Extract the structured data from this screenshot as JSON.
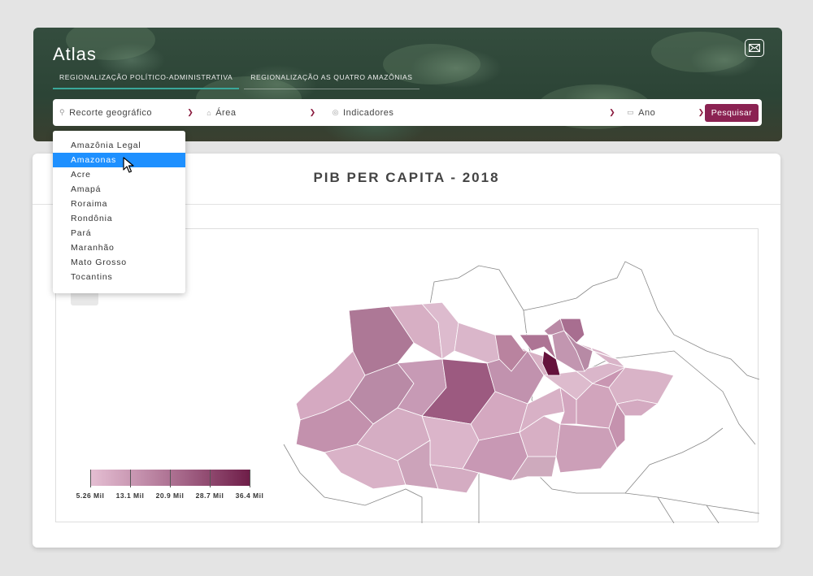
{
  "header": {
    "title": "Atlas",
    "tabs": [
      {
        "label": "REGIONALIZAÇÃO POLÍTICO-ADMINISTRATIVA",
        "active": true
      },
      {
        "label": "REGIONALIZAÇÃO AS QUATRO AMAZÔNIAS",
        "active": false
      }
    ]
  },
  "filters": {
    "geo": {
      "label": "Recorte geográfico",
      "icon": "map-pin-icon"
    },
    "area": {
      "label": "Área",
      "icon": "building-icon"
    },
    "indicators": {
      "label": "Indicadores",
      "icon": "target-icon"
    },
    "year": {
      "label": "Ano",
      "icon": "calendar-icon"
    },
    "search_label": "Pesquisar"
  },
  "dropdown": {
    "items": [
      "Amazônia Legal",
      "Amazonas",
      "Acre",
      "Amapá",
      "Roraima",
      "Rondônia",
      "Pará",
      "Maranhão",
      "Mato Grosso",
      "Tocantins"
    ],
    "selected": "Amazonas"
  },
  "chart": {
    "title": "PIB PER CAPITA - 2018"
  },
  "legend": {
    "labels": [
      "5.26 Mil",
      "13.1 Mil",
      "20.9 Mil",
      "28.7 Mil",
      "36.4 Mil"
    ],
    "color_low": "#e5bfd3",
    "color_high": "#6e1d48"
  },
  "colors": {
    "accent": "#8b2252",
    "tab_active": "#3aa89a",
    "selected_item": "#1e90ff"
  }
}
